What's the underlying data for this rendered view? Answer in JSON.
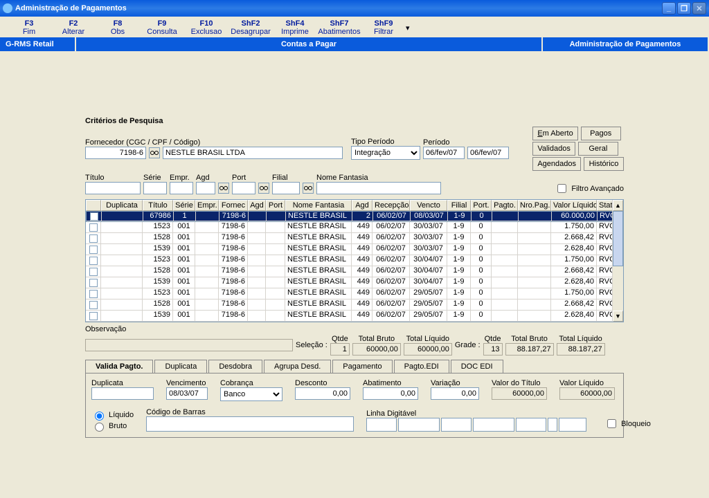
{
  "window": {
    "title": "Administração de Pagamentos"
  },
  "toolbar": [
    {
      "fkey": "F3",
      "label": "Fim"
    },
    {
      "fkey": "F2",
      "label": "Alterar"
    },
    {
      "fkey": "F8",
      "label": "Obs"
    },
    {
      "fkey": "F9",
      "label": "Consulta"
    },
    {
      "fkey": "F10",
      "label": "Exclusao"
    },
    {
      "fkey": "ShF2",
      "label": "Desagrupar"
    },
    {
      "fkey": "ShF4",
      "label": "Imprime"
    },
    {
      "fkey": "ShF7",
      "label": "Abatimentos"
    },
    {
      "fkey": "ShF9",
      "label": "Filtrar"
    }
  ],
  "bluebar": {
    "left": "G-RMS Retail",
    "center": "Contas a Pagar",
    "right": "Administração de Pagamentos"
  },
  "criteria": {
    "title": "Critérios de Pesquisa",
    "fornecedor_label": "Fornecedor (CGC / CPF / Código)",
    "fornecedor_code": "7198-6",
    "fornecedor_name": "NESTLE BRASIL LTDA",
    "tipo_periodo_label": "Tipo Período",
    "tipo_periodo": "Integração",
    "periodo_label": "Período",
    "periodo_de": "06/fev/07",
    "periodo_ate": "06/fev/07",
    "titulo_label": "Título",
    "serie_label": "Série",
    "empr_label": "Empr.",
    "agd_label": "Agd",
    "port_label": "Port",
    "filial_label": "Filial",
    "nome_fantasia_label": "Nome Fantasia",
    "filtro_avancado": "Filtro Avançado",
    "btns": {
      "em_aberto": "Em Aberto",
      "pagos": "Pagos",
      "validados": "Validados",
      "geral": "Geral",
      "agendados": "Agendados",
      "historico": "Histórico"
    }
  },
  "grid": {
    "headers": [
      "",
      "Duplicata",
      "Título",
      "Série",
      "Empr.",
      "Fornec",
      "Agd",
      "Port",
      "Nome Fantasia",
      "Agd",
      "Recepção",
      "Vencto",
      "Filial",
      "Port.",
      "Pagto.",
      "Nro.Pag.",
      "Valor Líquido",
      "Status"
    ],
    "rows": [
      {
        "chk": true,
        "dup": "",
        "tit": "67986",
        "ser": "1",
        "emp": "",
        "for": "7198-6",
        "agd0": "",
        "port0": "",
        "nom": "NESTLE BRASIL",
        "agd": "2",
        "rec": "06/02/07",
        "ven": "08/03/07",
        "fil": "1-9",
        "por": "0",
        "pag": "",
        "nrp": "",
        "val": "60.000,00",
        "sta": "RVC"
      },
      {
        "chk": false,
        "dup": "",
        "tit": "1523",
        "ser": "001",
        "emp": "",
        "for": "7198-6",
        "agd0": "",
        "port0": "",
        "nom": "NESTLE BRASIL",
        "agd": "449",
        "rec": "06/02/07",
        "ven": "30/03/07",
        "fil": "1-9",
        "por": "0",
        "pag": "",
        "nrp": "",
        "val": "1.750,00",
        "sta": "RVC"
      },
      {
        "chk": false,
        "dup": "",
        "tit": "1528",
        "ser": "001",
        "emp": "",
        "for": "7198-6",
        "agd0": "",
        "port0": "",
        "nom": "NESTLE BRASIL",
        "agd": "449",
        "rec": "06/02/07",
        "ven": "30/03/07",
        "fil": "1-9",
        "por": "0",
        "pag": "",
        "nrp": "",
        "val": "2.668,42",
        "sta": "RVC"
      },
      {
        "chk": false,
        "dup": "",
        "tit": "1539",
        "ser": "001",
        "emp": "",
        "for": "7198-6",
        "agd0": "",
        "port0": "",
        "nom": "NESTLE BRASIL",
        "agd": "449",
        "rec": "06/02/07",
        "ven": "30/03/07",
        "fil": "1-9",
        "por": "0",
        "pag": "",
        "nrp": "",
        "val": "2.628,40",
        "sta": "RVC"
      },
      {
        "chk": false,
        "dup": "",
        "tit": "1523",
        "ser": "001",
        "emp": "",
        "for": "7198-6",
        "agd0": "",
        "port0": "",
        "nom": "NESTLE BRASIL",
        "agd": "449",
        "rec": "06/02/07",
        "ven": "30/04/07",
        "fil": "1-9",
        "por": "0",
        "pag": "",
        "nrp": "",
        "val": "1.750,00",
        "sta": "RVC"
      },
      {
        "chk": false,
        "dup": "",
        "tit": "1528",
        "ser": "001",
        "emp": "",
        "for": "7198-6",
        "agd0": "",
        "port0": "",
        "nom": "NESTLE BRASIL",
        "agd": "449",
        "rec": "06/02/07",
        "ven": "30/04/07",
        "fil": "1-9",
        "por": "0",
        "pag": "",
        "nrp": "",
        "val": "2.668,42",
        "sta": "RVC"
      },
      {
        "chk": false,
        "dup": "",
        "tit": "1539",
        "ser": "001",
        "emp": "",
        "for": "7198-6",
        "agd0": "",
        "port0": "",
        "nom": "NESTLE BRASIL",
        "agd": "449",
        "rec": "06/02/07",
        "ven": "30/04/07",
        "fil": "1-9",
        "por": "0",
        "pag": "",
        "nrp": "",
        "val": "2.628,40",
        "sta": "RVC"
      },
      {
        "chk": false,
        "dup": "",
        "tit": "1523",
        "ser": "001",
        "emp": "",
        "for": "7198-6",
        "agd0": "",
        "port0": "",
        "nom": "NESTLE BRASIL",
        "agd": "449",
        "rec": "06/02/07",
        "ven": "29/05/07",
        "fil": "1-9",
        "por": "0",
        "pag": "",
        "nrp": "",
        "val": "1.750,00",
        "sta": "RVC"
      },
      {
        "chk": false,
        "dup": "",
        "tit": "1528",
        "ser": "001",
        "emp": "",
        "for": "7198-6",
        "agd0": "",
        "port0": "",
        "nom": "NESTLE BRASIL",
        "agd": "449",
        "rec": "06/02/07",
        "ven": "29/05/07",
        "fil": "1-9",
        "por": "0",
        "pag": "",
        "nrp": "",
        "val": "2.668,42",
        "sta": "RVC"
      },
      {
        "chk": false,
        "dup": "",
        "tit": "1539",
        "ser": "001",
        "emp": "",
        "for": "7198-6",
        "agd0": "",
        "port0": "",
        "nom": "NESTLE BRASIL",
        "agd": "449",
        "rec": "06/02/07",
        "ven": "29/05/07",
        "fil": "1-9",
        "por": "0",
        "pag": "",
        "nrp": "",
        "val": "2.628,40",
        "sta": "RVC"
      }
    ]
  },
  "obs_label": "Observação",
  "summary": {
    "selecao": "Seleção :",
    "qtde_label": "Qtde",
    "total_bruto_label": "Total Bruto",
    "total_liquido_label": "Total Líquido",
    "sel_qtde": "1",
    "sel_bruto": "60000,00",
    "sel_liquido": "60000,00",
    "grade": "Grade :",
    "gr_qtde": "13",
    "gr_bruto": "88.187,27",
    "gr_liquido": "88.187,27"
  },
  "tabs": {
    "valida": "Valida Pagto.",
    "duplicata": "Duplicata",
    "desdobra": "Desdobra",
    "agrupa": "Agrupa Desd.",
    "pagamento": "Pagamento",
    "pagto_edi": "Pagto.EDI",
    "doc_edi": "DOC EDI"
  },
  "form": {
    "duplicata": "Duplicata",
    "vencimento": "Vencimento",
    "cobranca": "Cobrança",
    "desconto": "Desconto",
    "abatimento": "Abatimento",
    "variacao": "Variação",
    "valor_titulo": "Valor do Título",
    "valor_liq": "Valor Líquido",
    "venc_val": "08/03/07",
    "cob_val": "Banco",
    "desc_val": "0,00",
    "abat_val": "0,00",
    "var_val": "0,00",
    "vt_val": "60000,00",
    "vl_val": "60000,00",
    "liquido": "Líquido",
    "bruto": "Bruto",
    "codigo_barras": "Código de Barras",
    "linha_digitavel": "Linha Digitável",
    "bloqueio": "Bloqueio"
  }
}
